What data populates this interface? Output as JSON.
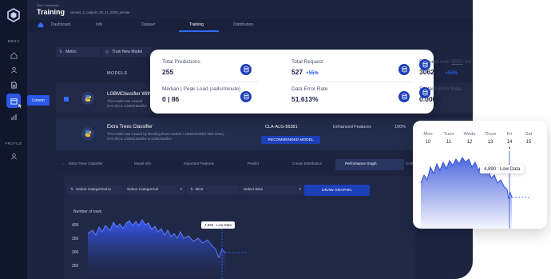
{
  "header": {
    "breadcrumb": "Main / Dashboard",
    "title": "Training",
    "file": "census_2_outputs_20_11_2023_private"
  },
  "tabs": [
    "Dashboard",
    "Info",
    "Dataset",
    "Training",
    "Distribution"
  ],
  "active_tab": "Training",
  "sidebar": {
    "menu_label": "MENU",
    "profile_label": "PROFILE",
    "tooltip": "Lorem",
    "icons": [
      "home-icon",
      "user-icon",
      "document-icon",
      "calendar-icon",
      "bar-chart-icon",
      "person-icon"
    ]
  },
  "controls": {
    "metric": "Metric",
    "train_new_model": "Train New Model",
    "models_header": "MODELS"
  },
  "models": [
    {
      "name": "LGBMClassifier With",
      "desc1": "This model was created",
      "desc2": "(0<0.05) & LGBMClassifier"
    },
    {
      "name": "Extra Trees Classifier",
      "desc1": "This model was created by blending these models: LGBMClassifier With Binary",
      "desc2": "(0<0.05) & LGBMClassifier & XGBClassifier",
      "id": "CLA-ALG-55381",
      "feature": "Enhanced Features",
      "percent": "100%",
      "recommend": "RECOMMENDED MODEL"
    }
  ],
  "detail_tabs": [
    "Extra Trees Classifier",
    "Model Info",
    "Important Features",
    "Predict",
    "Create Distribution",
    "Performance Graph",
    "Conf"
  ],
  "detail_active": "Performance Graph",
  "selectors": {
    "categorical_a": "Select Categorical (x",
    "categorical_b": "Select Categorical",
    "bins": "Bins",
    "select_bins": "Select Bins",
    "draw": "DRAW GRAPHIC"
  },
  "bg_chart": {
    "ylabel": "Number of rows",
    "ticks": [
      "400",
      "350",
      "300",
      "250"
    ],
    "tooltip": "4,890 : Low Data"
  },
  "metrics": [
    {
      "label": "Total Predictions",
      "value": "255",
      "delta": ""
    },
    {
      "label": "Total Request",
      "value": "527",
      "delta": "+55%"
    },
    {
      "label_pre": "Request over ",
      "label_u": "2000",
      "label_post": " ms",
      "value": "306240",
      "delta": "+55%"
    },
    {
      "label": "Median | Peak Load (calls/minute)",
      "value": "0 | 86",
      "delta": ""
    },
    {
      "label": "Data Error Rate",
      "value": "51.613%",
      "delta": ""
    },
    {
      "label": "System Error Rate",
      "value": "0.000%",
      "delta": ""
    }
  ],
  "mini_chart": {
    "days": [
      "Mon",
      "Tues",
      "Weds",
      "Thurs",
      "Fri",
      "Sat"
    ],
    "dates": [
      "10",
      "11",
      "12",
      "13",
      "14",
      "15"
    ],
    "tooltip": "4,890 : Low Data",
    "accent": "#2f4fd8"
  }
}
